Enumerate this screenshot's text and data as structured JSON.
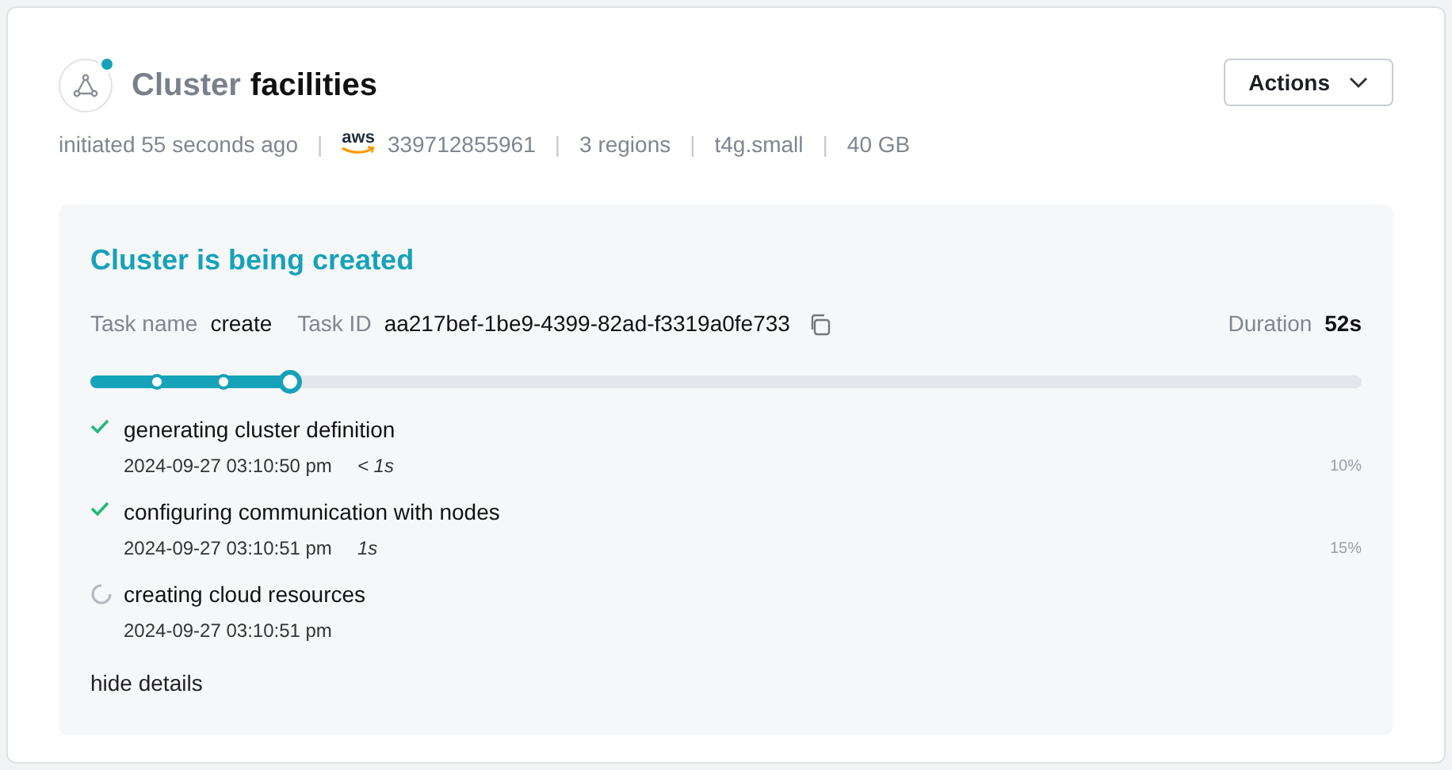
{
  "header": {
    "status_dot": true,
    "title_prefix": "Cluster",
    "title_name": "facilities",
    "actions_button": "Actions"
  },
  "meta": [
    {
      "kind": "text",
      "text": "initiated 55 seconds ago"
    },
    {
      "kind": "separator",
      "text": "|"
    },
    {
      "kind": "logo",
      "text": "aws"
    },
    {
      "kind": "text",
      "text": "339712855961"
    },
    {
      "kind": "separator",
      "text": "|"
    },
    {
      "kind": "text",
      "text": "3 regions"
    },
    {
      "kind": "separator",
      "text": "|"
    },
    {
      "kind": "text",
      "text": "t4g.small"
    },
    {
      "kind": "separator",
      "text": "|"
    },
    {
      "kind": "text",
      "text": "40 GB"
    }
  ],
  "task": {
    "heading": "Cluster is being created",
    "task_name_label": "Task name",
    "task_name": "create",
    "task_id_label": "Task ID",
    "task_id": "aa217bef-1be9-4399-82ad-f3319a0fe733",
    "duration_label": "Duration",
    "duration": "52s",
    "progress": {
      "level": 0.157
    },
    "steps": [
      {
        "kind": "done",
        "label": "generating cluster definition",
        "time": "2024-09-27 03:10:50 pm",
        "elapsed": "< 1s",
        "percent": "10%"
      },
      {
        "kind": "done",
        "label": "configuring communication with nodes",
        "time": "2024-09-27 03:10:51 pm",
        "elapsed": "1s",
        "percent": "15%"
      },
      {
        "kind": "running",
        "label": "creating cloud resources",
        "time": "2024-09-27 03:10:51 pm"
      }
    ],
    "toggle": "hide details"
  }
}
